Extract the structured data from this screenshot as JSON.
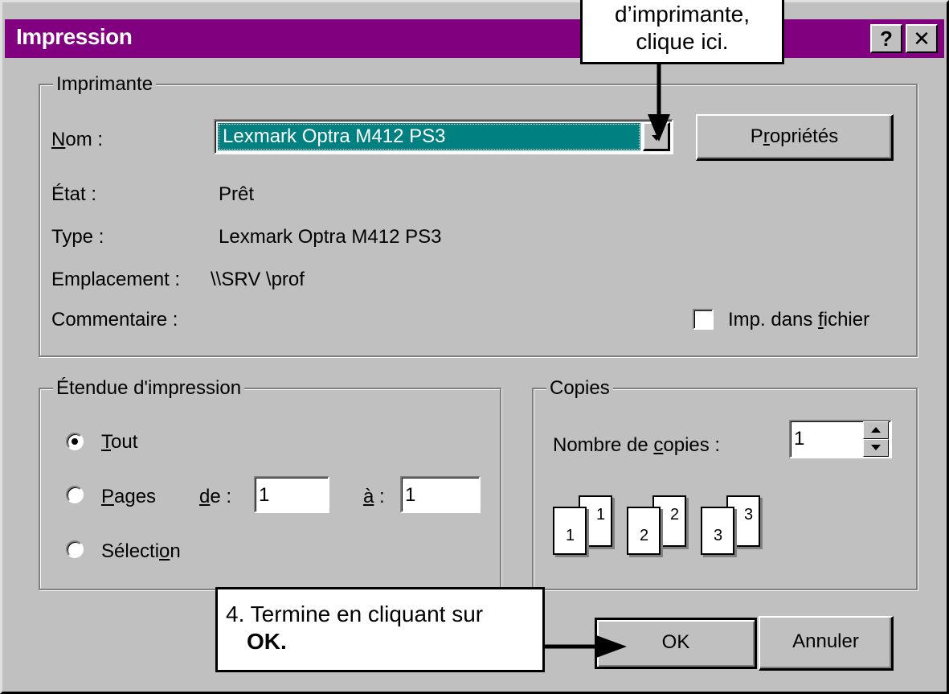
{
  "window": {
    "title": "Impression",
    "help_label": "?",
    "close_label": "✕"
  },
  "printer_group": {
    "legend": "Imprimante",
    "name_label_u": "N",
    "name_label_rest": "om :",
    "selected_printer": "Lexmark Optra M412 PS3",
    "dropdown_icon": "chevron-down-icon",
    "properties_label_pre": "P",
    "properties_label_u": "r",
    "properties_label_post": "opriétés",
    "status_label": "État :",
    "status_value": "Prêt",
    "type_label": "Type :",
    "type_value": "Lexmark Optra M412 PS3",
    "location_label": "Emplacement :",
    "location_value": "\\\\SRV \\prof",
    "comment_label": "Commentaire :",
    "print_to_file_pre": "Imp. dans ",
    "print_to_file_u": "f",
    "print_to_file_post": "ichier",
    "print_to_file_checked": false
  },
  "range_group": {
    "legend": "Étendue d'impression",
    "all_u": "T",
    "all_rest": "out",
    "pages_u": "P",
    "pages_rest": "ages",
    "from_u": "d",
    "from_rest": "e :",
    "from_value": "1",
    "to_u": "à",
    "to_rest": " :",
    "to_value": "1",
    "selection_pre": "Sélecti",
    "selection_u": "o",
    "selection_post": "n",
    "selected_option": "all"
  },
  "copies_group": {
    "legend": "Copies",
    "count_pre": "Nombre de ",
    "count_u": "c",
    "count_post": "opies :",
    "count_value": "1",
    "collate_icons": [
      {
        "back": "1",
        "front": "1"
      },
      {
        "back": "2",
        "front": "2"
      },
      {
        "back": "3",
        "front": "3"
      }
    ]
  },
  "buttons": {
    "ok_label": "OK",
    "cancel_label": "Annuler"
  },
  "callouts": {
    "top_line1": "d’imprimante,",
    "top_line2": "clique ici.",
    "bottom_line1": "4. Termine en cliquant sur",
    "bottom_line2": "OK."
  },
  "colors": {
    "titlebar": "#800080",
    "selection": "#008080",
    "face": "#c0c0c0"
  }
}
